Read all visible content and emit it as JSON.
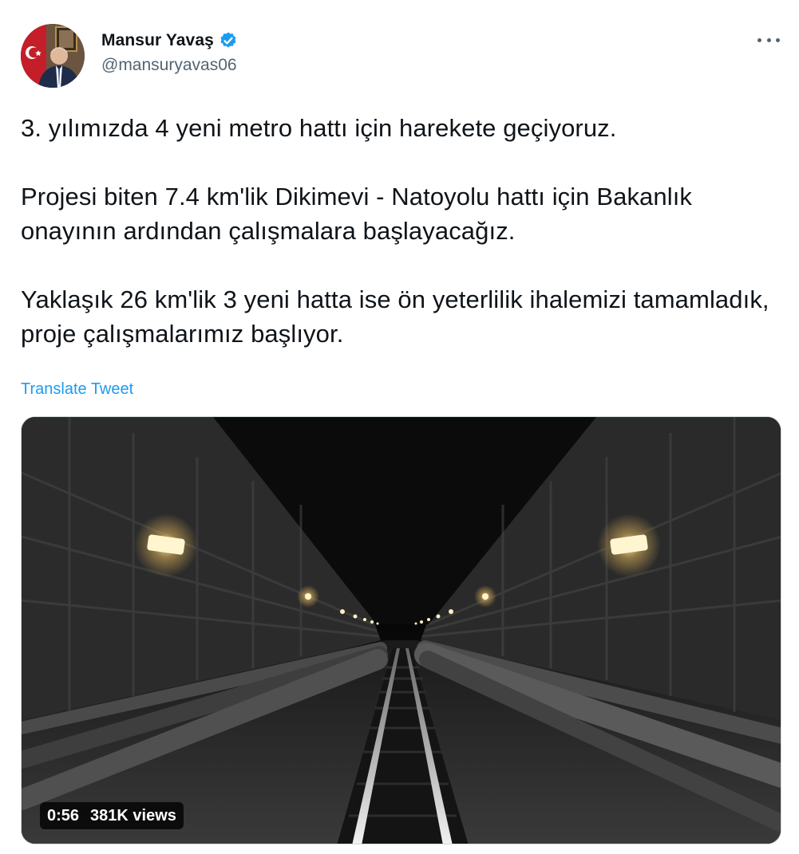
{
  "author": {
    "display_name": "Mansur Yavaş",
    "handle": "@mansuryavas06",
    "verified": true
  },
  "tweet": {
    "paragraphs": [
      "3. yılımızda 4 yeni metro hattı için harekete geçiyoruz.",
      "Projesi biten 7.4 km'lik Dikimevi - Natoyolu hattı için Bakanlık onayının ardından çalışmalara başlayacağız.",
      "Yaklaşık 26 km'lik 3 yeni hatta ise ön yeterlilik ihalemizi tamamladık, proje çalışmalarımız başlıyor."
    ],
    "translate_label": "Translate Tweet"
  },
  "video": {
    "duration": "0:56",
    "views": "381K views"
  },
  "colors": {
    "link": "#1d9bf0",
    "text": "#0f1419",
    "muted": "#536471"
  },
  "icons": {
    "verified": "verified-badge-icon",
    "more": "more-options-icon"
  }
}
